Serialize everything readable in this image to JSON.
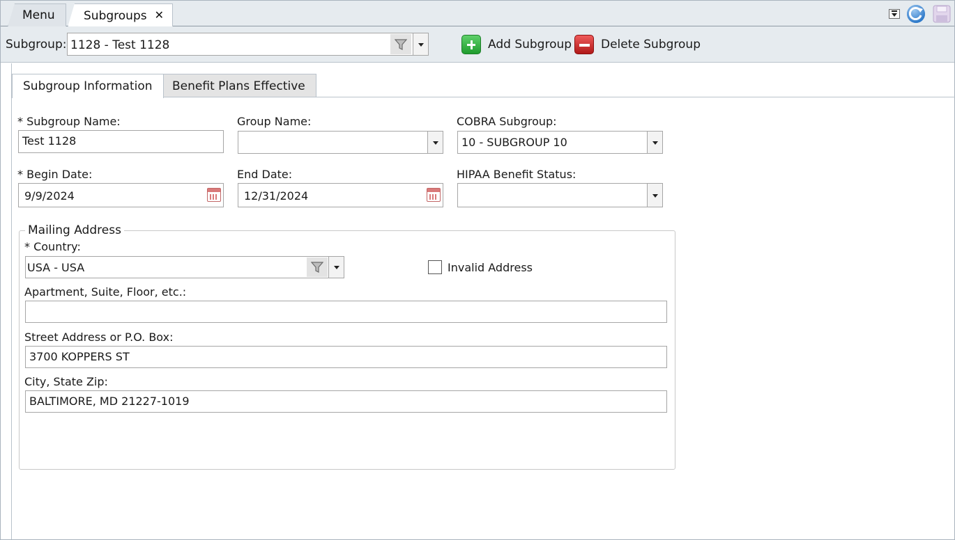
{
  "tabs": [
    {
      "label": "Menu"
    },
    {
      "label": "Subgroups",
      "close": "✕"
    }
  ],
  "toolbar": {
    "subgroup_label": "Subgroup:",
    "subgroup_value": "1128 - Test 1128",
    "add_label": "Add Subgroup",
    "delete_label": "Delete Subgroup"
  },
  "content_tabs": [
    {
      "label": "Subgroup Information",
      "active": true
    },
    {
      "label": "Benefit Plans Effective",
      "active": false
    }
  ],
  "form": {
    "subgroup_name_label": "* Subgroup Name:",
    "subgroup_name_value": "Test 1128",
    "group_name_label": "Group Name:",
    "group_name_value": "",
    "cobra_label": "COBRA Subgroup:",
    "cobra_value": "10 - SUBGROUP 10",
    "begin_label": "* Begin Date:",
    "begin_value": "9/9/2024",
    "end_label": "End Date:",
    "end_value": "12/31/2024",
    "hipaa_label": "HIPAA Benefit Status:",
    "hipaa_value": ""
  },
  "mailing": {
    "legend": "Mailing Address",
    "country_label": "* Country:",
    "country_value": "USA - USA",
    "invalid_label": "Invalid Address",
    "invalid_checked": false,
    "apt_label": "Apartment, Suite, Floor, etc.:",
    "apt_value": "",
    "street_label": "Street Address or P.O. Box:",
    "street_value": "3700 KOPPERS ST",
    "city_label": "City, State Zip:",
    "city_value": "BALTIMORE, MD 21227-1019"
  },
  "colors": {
    "chrome": "#e6ebef",
    "border": "#a6a6a6",
    "add": "#1f9c2e",
    "delete": "#b01818"
  }
}
